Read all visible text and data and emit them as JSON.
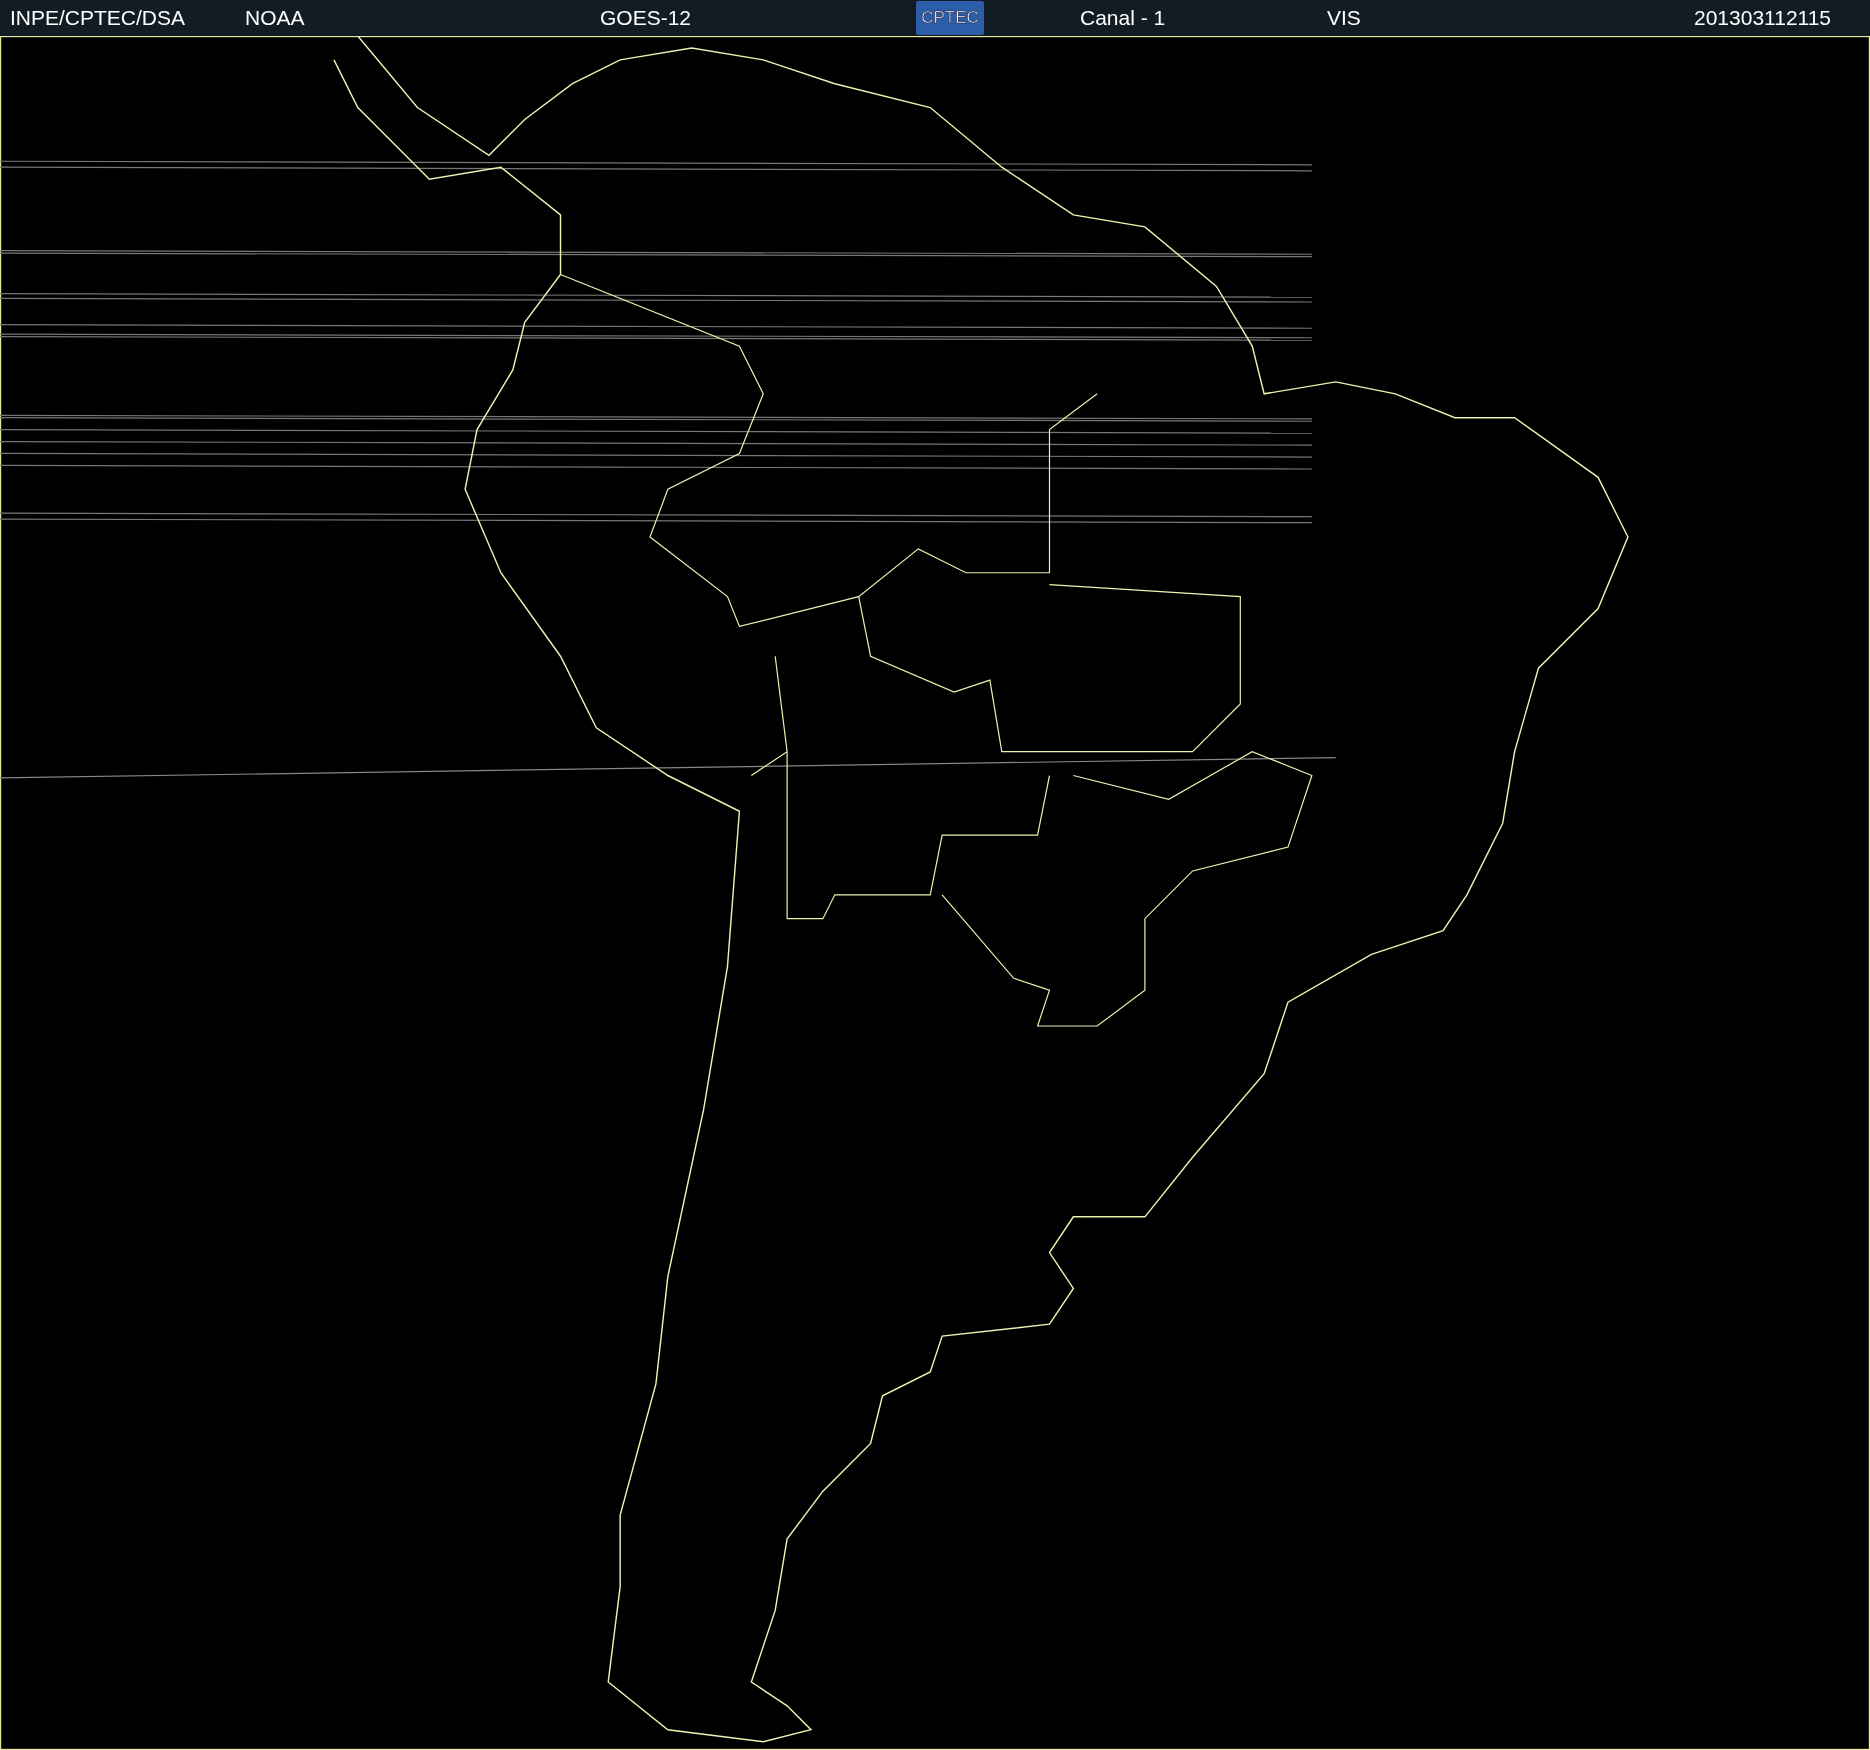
{
  "header": {
    "source": "INPE/CPTEC/DSA",
    "agency": "NOAA",
    "satellite": "GOES-12",
    "logo_text": "CPTEC",
    "channel": "Canal - 1",
    "band": "VIS",
    "timestamp": "201303112115"
  }
}
